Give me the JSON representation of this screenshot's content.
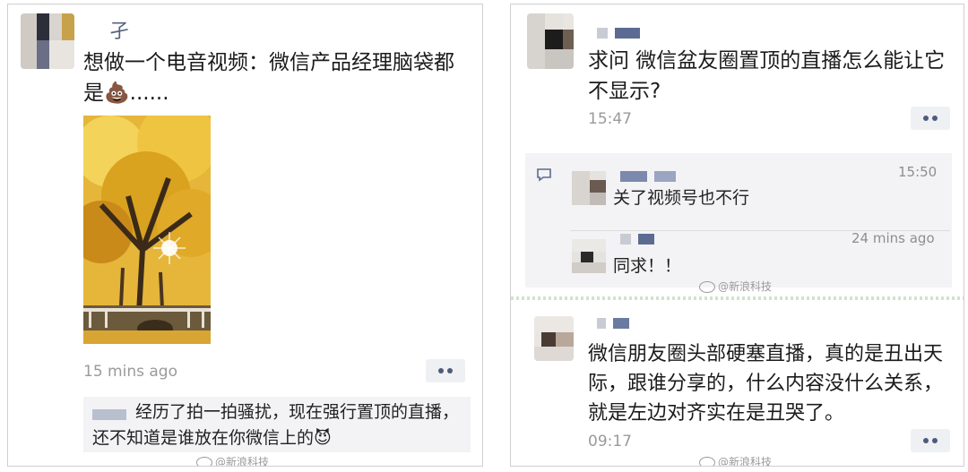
{
  "left": {
    "avatar_name_glyph": "孑",
    "post_text": "想做一个电音视频：微信产品经理脑袋都是💩......",
    "timestamp": "15 mins ago",
    "more_label": "••",
    "comment_text": "经历了拍一拍骚扰，现在强行置顶的直播，还不知道是谁放在你微信上的😈",
    "watermark": "@新浪科技"
  },
  "right": {
    "post1": {
      "text": "求问 微信盆友圈置顶的直播怎么能让它不显示?",
      "timestamp": "15:47",
      "more_label": "••",
      "comments": [
        {
          "text": "关了视频号也不行",
          "time": "15:50"
        },
        {
          "text": "同求！！",
          "time": "24 mins ago"
        }
      ]
    },
    "post2": {
      "text": "微信朋友圈头部硬塞直播，真的是丑出天际，跟谁分享的，什么内容没什么关系，就是左边对齐实在是丑哭了。",
      "timestamp": "09:17",
      "more_label": "••"
    },
    "watermark": "@新浪科技"
  },
  "colors": {
    "more_dots": "#4d5b7b",
    "time_text": "#9a9a9a",
    "comment_bg": "#f3f3f5"
  },
  "icons": [
    "comment-bubble-icon",
    "weibo-icon"
  ]
}
